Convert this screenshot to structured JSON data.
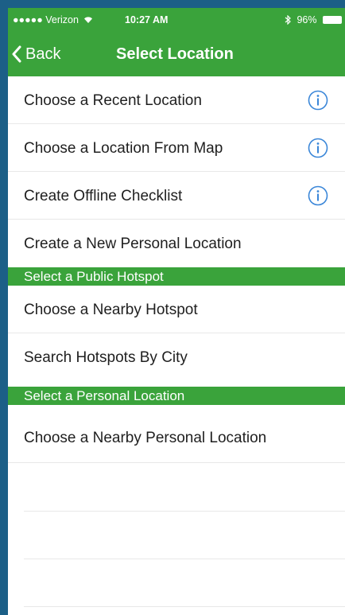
{
  "status_bar": {
    "carrier": "●●●●● Verizon",
    "time": "10:27 AM",
    "battery": "96%"
  },
  "nav": {
    "back_label": "Back",
    "title": "Select Location"
  },
  "rows_top": [
    {
      "label": "Choose a Recent Location",
      "has_info": true
    },
    {
      "label": "Choose a Location From Map",
      "has_info": true
    },
    {
      "label": "Create Offline Checklist",
      "has_info": true
    },
    {
      "label": "Create a New Personal Location",
      "has_info": false
    }
  ],
  "section_public": {
    "label": "Select a Public Hotspot",
    "rows": [
      {
        "label": "Choose a Nearby Hotspot"
      },
      {
        "label": "Search Hotspots By City"
      }
    ]
  },
  "section_personal": {
    "label": "Select a Personal Location",
    "rows": [
      {
        "label": "Choose a Nearby Personal Location"
      }
    ]
  },
  "colors": {
    "brand_green": "#3aa33b",
    "info_blue": "#3a86d8",
    "background_blue": "#1c5f87"
  },
  "icons": {
    "back": "chevron-left-icon",
    "info": "info-circle-icon",
    "wifi": "wifi-icon",
    "bluetooth": "bluetooth-icon",
    "battery": "battery-icon"
  }
}
